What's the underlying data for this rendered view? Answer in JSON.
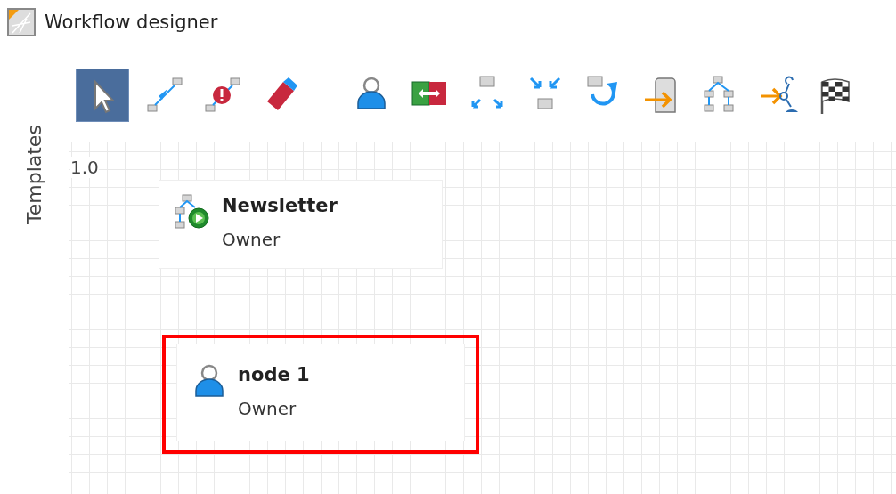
{
  "window": {
    "title": "Workflow designer"
  },
  "toolbar": {
    "groups": [
      [
        {
          "kind": "pointer",
          "selected": true
        },
        {
          "kind": "connector",
          "selected": false
        },
        {
          "kind": "error-connector",
          "selected": false
        },
        {
          "kind": "eraser",
          "selected": false
        }
      ],
      [
        {
          "kind": "person",
          "selected": false
        },
        {
          "kind": "swap",
          "selected": false
        },
        {
          "kind": "split",
          "selected": false
        },
        {
          "kind": "merge",
          "selected": false
        },
        {
          "kind": "loop",
          "selected": false
        },
        {
          "kind": "server-input",
          "selected": false
        },
        {
          "kind": "tree",
          "selected": false
        },
        {
          "kind": "junction",
          "selected": false
        },
        {
          "kind": "finish",
          "selected": false
        }
      ]
    ]
  },
  "side_panel": {
    "label": "Templates"
  },
  "canvas": {
    "version": "1.0",
    "nodes": [
      {
        "kind": "subprocess",
        "title": "Newsletter",
        "subtitle": "Owner",
        "selected": false
      },
      {
        "kind": "person",
        "title": "node 1",
        "subtitle": "Owner",
        "selected": true
      }
    ]
  }
}
